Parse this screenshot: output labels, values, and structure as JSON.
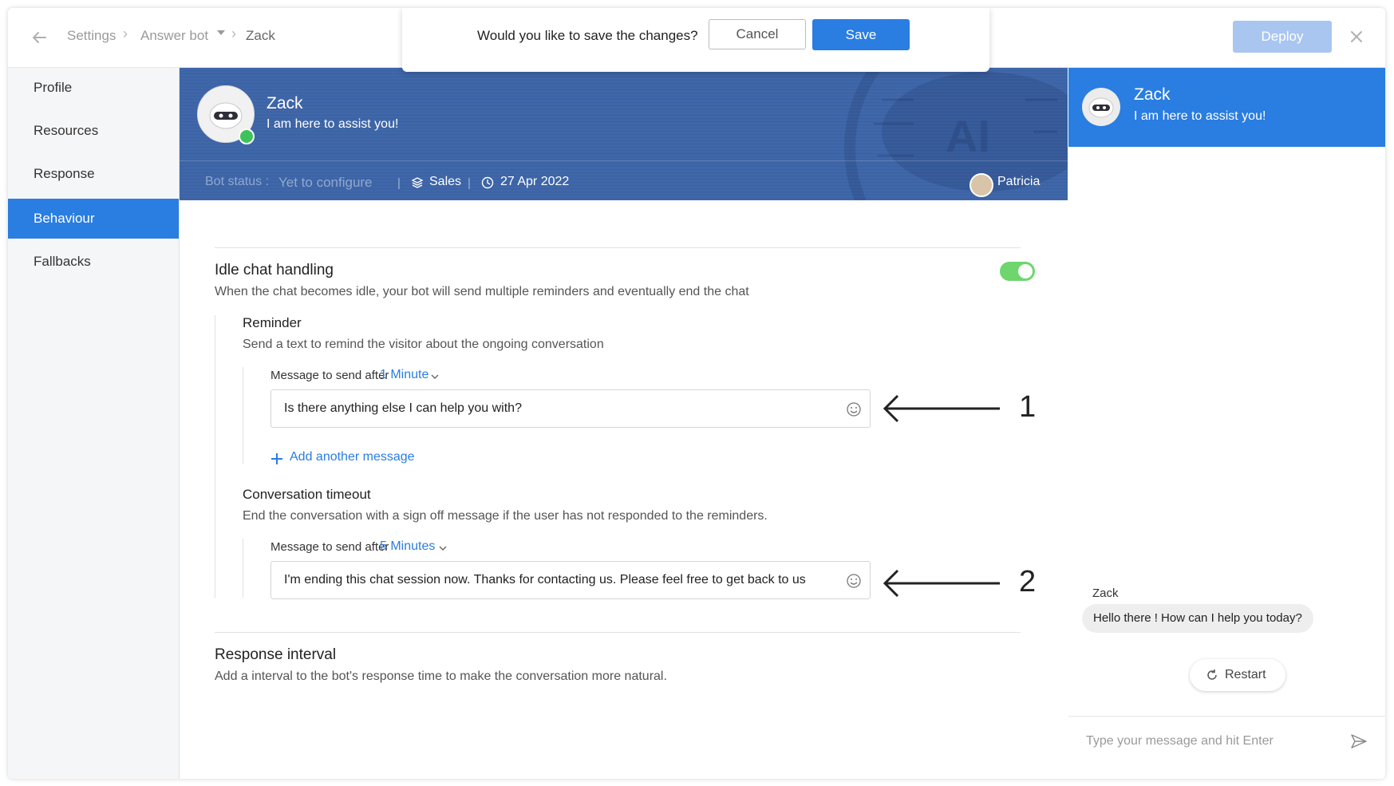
{
  "topbar": {
    "breadcrumbs": [
      "Settings",
      "Answer bot",
      "Zack"
    ],
    "deploy_label": "Deploy"
  },
  "save_dialog": {
    "question": "Would you like to save the changes?",
    "cancel_label": "Cancel",
    "save_label": "Save"
  },
  "sidebar": {
    "items": [
      {
        "label": "Profile"
      },
      {
        "label": "Resources"
      },
      {
        "label": "Response"
      },
      {
        "label": "Behaviour",
        "active": true
      },
      {
        "label": "Fallbacks"
      }
    ]
  },
  "bot": {
    "name": "Zack",
    "tagline": "I am here to assist you!",
    "status_label": "Bot status :",
    "status_value": "Yet to configure",
    "department": "Sales",
    "date": "27 Apr 2022",
    "owner": "Patricia",
    "watermark": "AI"
  },
  "idle": {
    "title": "Idle chat handling",
    "description": "When the chat becomes idle, your bot will send multiple reminders and eventually end the chat",
    "enabled": true,
    "reminder": {
      "title": "Reminder",
      "description": "Send a text to remind the visitor about the ongoing conversation",
      "send_after_label": "Message to send after",
      "send_after_value": "1 Minute",
      "message": "Is there anything else I can help you with?",
      "add_label": "Add another message"
    },
    "timeout": {
      "title": "Conversation timeout",
      "description": "End the conversation with a sign off message if the user has not responded to the reminders.",
      "send_after_label": "Message to send after",
      "send_after_value": "5 Minutes",
      "message": "I'm ending this chat session now. Thanks for contacting us. Please feel free to get back to us"
    }
  },
  "response_interval": {
    "title": "Response interval",
    "description": "Add a interval to the bot's response time to make the conversation more natural."
  },
  "annotations": [
    "1",
    "2"
  ],
  "preview": {
    "name": "Zack",
    "tagline": "I am here to assist you!",
    "sender": "Zack",
    "message": "Hello there ! How can I help you today?",
    "restart_label": "Restart",
    "input_placeholder": "Type your message and hit Enter"
  },
  "colors": {
    "accent": "#2a7de1",
    "banner": "#3c64a6",
    "toggle_on": "#6ed66c",
    "online": "#3ec35b"
  },
  "icons": [
    "back-arrow-icon",
    "close-icon",
    "layers-icon",
    "clock-icon",
    "emoji-icon",
    "plus-icon",
    "chevron-down-icon",
    "refresh-icon",
    "send-icon",
    "bot-avatar-icon"
  ]
}
